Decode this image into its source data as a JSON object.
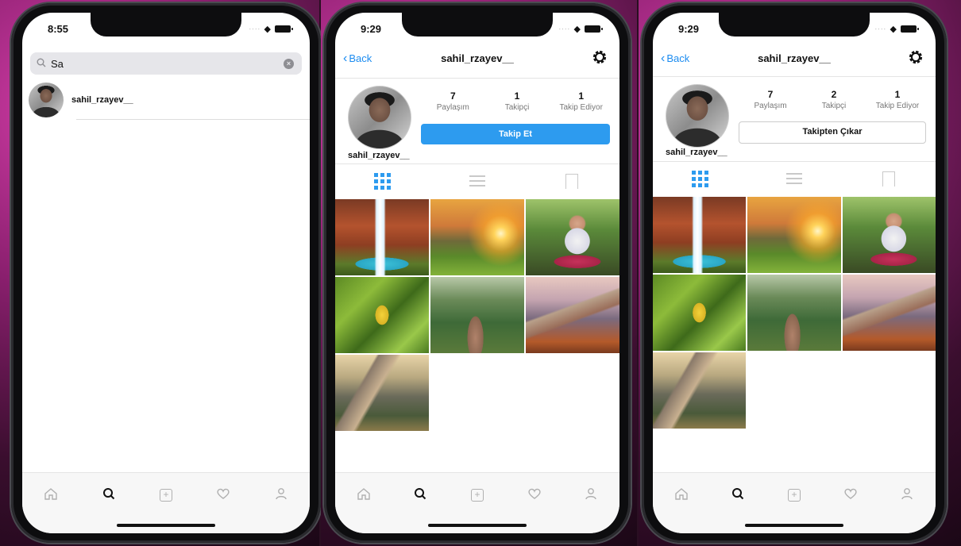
{
  "phones": [
    {
      "time": "8:55",
      "search": {
        "query": "Sa"
      },
      "results": [
        {
          "username": "sahil_rzayev__"
        }
      ]
    },
    {
      "time": "9:29",
      "nav": {
        "back_label": "Back",
        "title": "sahil_rzayev__"
      },
      "profile": {
        "username": "sahil_rzayev__",
        "stats": [
          {
            "value": "7",
            "label": "Paylaşım"
          },
          {
            "value": "1",
            "label": "Takipçi"
          },
          {
            "value": "1",
            "label": "Takip Ediyor"
          }
        ],
        "action_label": "Takip Et"
      },
      "photo_count": 7
    },
    {
      "time": "9:29",
      "nav": {
        "back_label": "Back",
        "title": "sahil_rzayev__"
      },
      "profile": {
        "username": "sahil_rzayev__",
        "stats": [
          {
            "value": "7",
            "label": "Paylaşım"
          },
          {
            "value": "2",
            "label": "Takipçi"
          },
          {
            "value": "1",
            "label": "Takip Ediyor"
          }
        ],
        "action_label": "Takipten Çıkar"
      },
      "photo_count": 7
    }
  ],
  "tab_bar": [
    "home-icon",
    "search-icon",
    "add-post-icon",
    "heart-icon",
    "profile-icon"
  ],
  "tab_bar_active": "search-icon",
  "colors": {
    "accent": "#2d9bef",
    "link": "#1c8cf0",
    "inactive": "#b0b0b0"
  }
}
